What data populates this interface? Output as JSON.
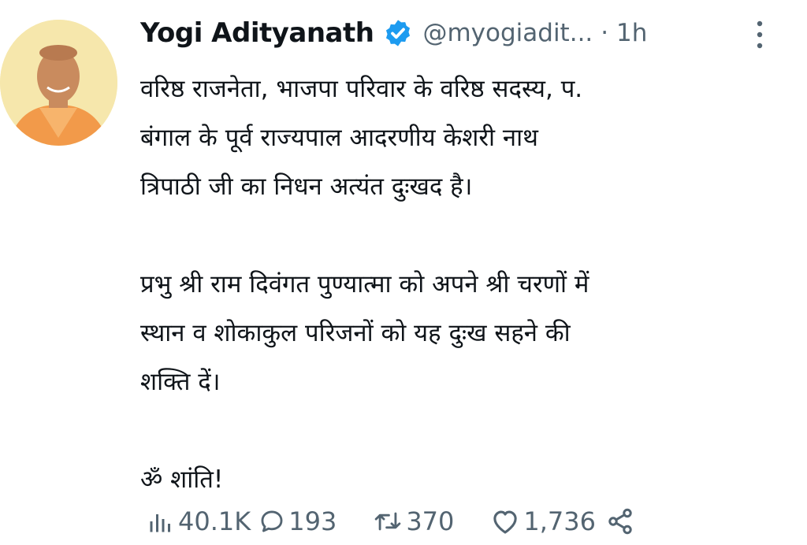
{
  "tweet": {
    "author_name": "Yogi Adityanath",
    "handle": "@myogiadit...",
    "time": "· 1h",
    "verified_icon": "verified-badge-icon",
    "text_lines_1": [
      "वरिष्ठ राजनेता, भाजपा परिवार के वरिष्ठ सदस्य, प.",
      "बंगाल के पूर्व राज्यपाल आदरणीय केशरी नाथ",
      "त्रिपाठी जी का निधन अत्यंत दुःखद है।"
    ],
    "text_lines_2": [
      "प्रभु श्री राम दिवंगत पुण्यात्मा को अपने श्री चरणों में",
      "स्थान व शोकाकुल परिजनों को यह दुःख सहने की",
      "शक्ति दें।"
    ],
    "text_line_3": "ॐ शांति!"
  },
  "actions": {
    "views": "40.1K",
    "replies": "193",
    "retweets": "370",
    "likes": "1,736"
  },
  "colors": {
    "verified": "#1d9bf0",
    "secondary": "#536471",
    "text": "#0f1419"
  }
}
